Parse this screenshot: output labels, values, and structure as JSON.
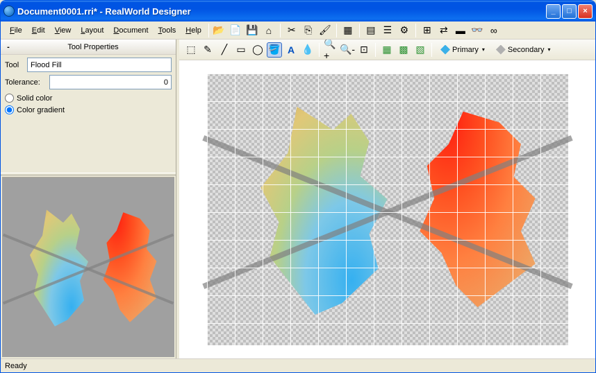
{
  "window": {
    "title": "Document0001.rri* - RealWorld Designer"
  },
  "menu": {
    "file": "File",
    "edit": "Edit",
    "view": "View",
    "layout": "Layout",
    "document": "Document",
    "tools": "Tools",
    "help": "Help"
  },
  "panel": {
    "title": "Tool Properties",
    "tool_label": "Tool",
    "tool_selected": "Flood Fill",
    "tolerance_label": "Tolerance:",
    "tolerance_value": "0",
    "solid_label": "Solid color",
    "gradient_label": "Color gradient"
  },
  "colors": {
    "primary_label": "Primary",
    "secondary_label": "Secondary",
    "primary_hex": "#3ab0e8",
    "secondary_hex": "#b0b0b0"
  },
  "status": {
    "text": "Ready"
  },
  "icons": {
    "open": "📂",
    "new": "📄",
    "save": "💾",
    "scanner": "⌂",
    "cut": "✂",
    "copy": "⎘",
    "paste": "📋",
    "brush_big": "🖌",
    "img1": "▦",
    "layers": "▤",
    "props": "☰",
    "settings": "⚙",
    "grid": "⊞",
    "swap": "⇄",
    "palette": "▬",
    "glasses": "👓",
    "link": "∞",
    "select": "⬚",
    "pencil": "✎",
    "line": "╱",
    "rect": "▭",
    "ellipse": "◯",
    "fill": "🪣",
    "text": "A",
    "eyedrop": "💧",
    "zoomin": "🔍+",
    "zoomout": "🔍-",
    "fit": "⊡",
    "g1": "▦",
    "g2": "▩",
    "g3": "▧"
  }
}
